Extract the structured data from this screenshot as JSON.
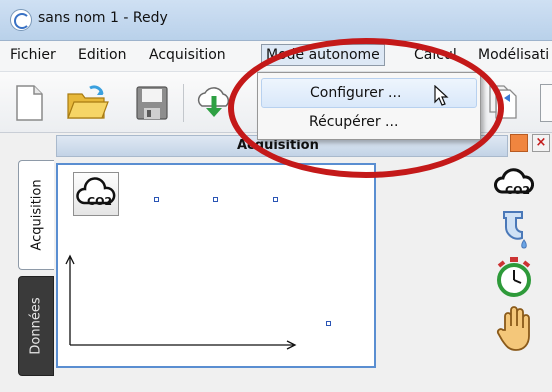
{
  "window": {
    "title": "sans nom 1 - Redy"
  },
  "menubar": {
    "items": [
      {
        "label": "Fichier"
      },
      {
        "label": "Edition"
      },
      {
        "label": "Acquisition"
      },
      {
        "label": "Mode autonome"
      },
      {
        "label": "Calcul"
      },
      {
        "label": "Modélisati"
      }
    ]
  },
  "dropdown": {
    "items": [
      {
        "label": "Configurer ..."
      },
      {
        "label": "Récupérer ..."
      }
    ]
  },
  "panel": {
    "header": "Acquisition"
  },
  "side_tabs": [
    {
      "label": "Acquisition"
    },
    {
      "label": "Données"
    }
  ],
  "graph": {
    "sensor_icon_label": "CO2"
  },
  "toolbar": {
    "icons": [
      "new-document-icon",
      "open-folder-icon",
      "save-icon",
      "download-cloud-icon",
      "copy-document-icon"
    ]
  },
  "right_icons": [
    "co2-sensor-icon",
    "water-tap-icon",
    "stopwatch-icon",
    "hand-icon"
  ],
  "colors": {
    "highlight_ellipse": "#c41919",
    "graph_border": "#5a8ed1"
  }
}
